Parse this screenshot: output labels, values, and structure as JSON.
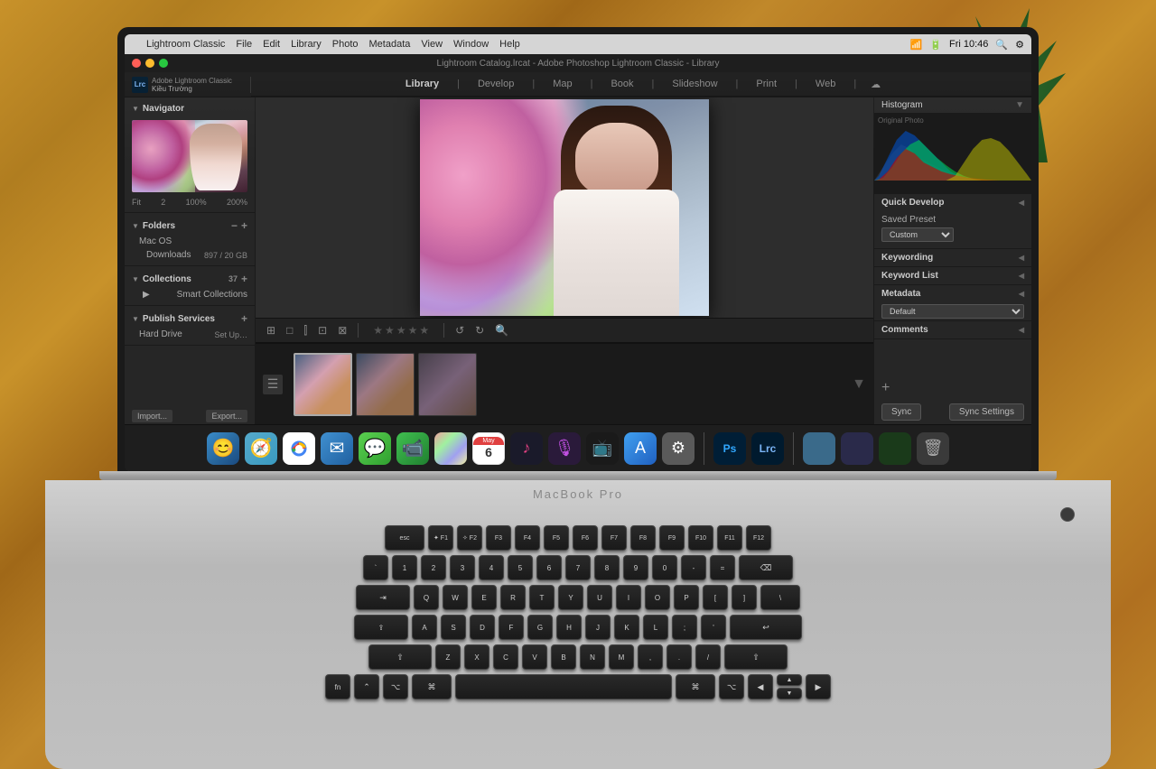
{
  "desk": {
    "background_description": "wooden desk surface"
  },
  "macbook": {
    "model_label": "MacBook Pro"
  },
  "macos": {
    "menubar": {
      "apple_symbol": "",
      "app_name": "Lightroom Classic",
      "menus": [
        "File",
        "Edit",
        "Library",
        "Photo",
        "Metadata",
        "View",
        "Window",
        "Help"
      ],
      "right_items": {
        "wifi": "📶",
        "time": "Fri 10:46",
        "battery": "🔋"
      }
    },
    "title_bar": {
      "title": "Lightroom Catalog.lrcat - Adobe Photoshop Lightroom Classic - Library"
    }
  },
  "lightroom": {
    "user": "Kiều Trường",
    "modules": [
      "Library",
      "Develop",
      "Map",
      "Book",
      "Slideshow",
      "Print",
      "Web"
    ],
    "active_module": "Library",
    "left_panel": {
      "navigator": {
        "label": "Navigator",
        "zoom_levels": [
          "Fit",
          "2",
          "100%",
          "200%"
        ]
      },
      "folders": {
        "label": "Folders",
        "items": [
          {
            "name": "Mac OS",
            "count": ""
          },
          {
            "name": "Downloads",
            "count": "897 / 20 GB"
          }
        ]
      },
      "collections": {
        "label": "Collections",
        "count": "37",
        "items": [
          {
            "name": "Smart Collections"
          }
        ]
      },
      "publish_services": {
        "label": "Publish Services",
        "items": [
          {
            "name": "Hard Drive"
          }
        ]
      },
      "actions": {
        "import": "Import...",
        "export": "Export..."
      }
    },
    "right_panel": {
      "histogram_label": "Histogram",
      "panels": [
        {
          "label": "Quick Develop",
          "has_arrow": true
        },
        {
          "label": "Keywording",
          "has_arrow": true
        },
        {
          "label": "Keyword List",
          "has_arrow": true
        },
        {
          "label": "Metadata",
          "has_arrow": true
        },
        {
          "label": "Comments",
          "has_arrow": true
        }
      ],
      "quick_develop": {
        "saved_preset_label": "Saved Preset",
        "preset_value": "Custom",
        "treatment_label": "Default",
        "sync_label": "Sync",
        "sync_settings_label": "Sync Settings"
      }
    },
    "toolbar": {
      "view_grid": "⊞",
      "view_loupe": "□",
      "view_compare": "⫿",
      "view_survey": "⊡",
      "view_people": "⊠"
    }
  },
  "dock": {
    "apps": [
      {
        "name": "Finder",
        "icon": "😊"
      },
      {
        "name": "Safari",
        "icon": "🧭"
      },
      {
        "name": "Chrome",
        "icon": ""
      },
      {
        "name": "Mail",
        "icon": "✉"
      },
      {
        "name": "Messages",
        "icon": "💬"
      },
      {
        "name": "FaceTime",
        "icon": "📹"
      },
      {
        "name": "Photos",
        "icon": ""
      },
      {
        "name": "Calendar",
        "icon": "📅"
      },
      {
        "name": "Music",
        "icon": "♪"
      },
      {
        "name": "Podcasts",
        "icon": "🎙"
      },
      {
        "name": "TV",
        "icon": "📺"
      },
      {
        "name": "AppStore",
        "icon": "A"
      },
      {
        "name": "SystemPrefs",
        "icon": "⚙"
      },
      {
        "name": "Photoshop",
        "label": "Ps"
      },
      {
        "name": "Lightroom",
        "label": "Lrc"
      }
    ]
  },
  "keyboard": {
    "rows": [
      [
        "esc",
        "✦ F1",
        "✧ F2",
        "❄ F3",
        "⊞ F4",
        "⌕ F5",
        "⌕ F6",
        "▸◂ F7",
        "▸▸ F8",
        "⏭ F9",
        "🔇 F10",
        "🔉 F11",
        "🔊 F12"
      ],
      [
        "`",
        "1",
        "2",
        "3",
        "4",
        "5",
        "6",
        "7",
        "8",
        "9",
        "0",
        "-",
        "=",
        "⌫"
      ],
      [
        "⇥",
        "Q",
        "W",
        "E",
        "R",
        "T",
        "Y",
        "U",
        "I",
        "O",
        "P",
        "[",
        "]",
        "\\"
      ],
      [
        "⇪",
        "A",
        "S",
        "D",
        "F",
        "G",
        "H",
        "J",
        "K",
        "L",
        ";",
        "'",
        "↩"
      ],
      [
        "⇧",
        "Z",
        "X",
        "C",
        "V",
        "B",
        "N",
        "M",
        ",",
        ".",
        "/",
        "⇧"
      ],
      [
        "fn",
        "⌃",
        "⌥",
        "⌘",
        " ",
        "⌘",
        "⌥",
        "◀",
        "▲▼",
        "▶"
      ]
    ]
  }
}
